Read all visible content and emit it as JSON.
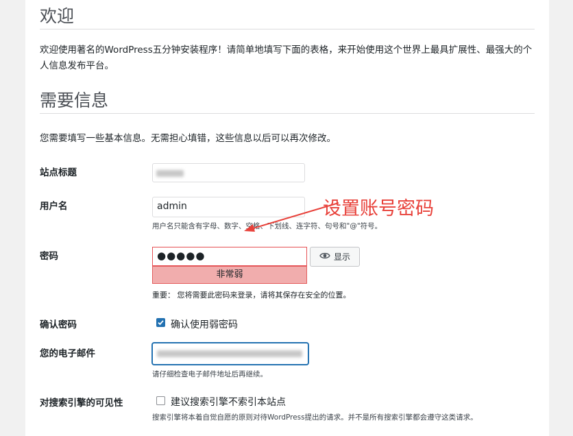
{
  "welcome": {
    "title": "欢迎",
    "intro": "欢迎使用著名的WordPress五分钟安装程序！请简单地填写下面的表格，来开始使用这个世界上最具扩展性、最强大的个人信息发布平台。"
  },
  "info": {
    "title": "需要信息",
    "description": "您需要填写一些基本信息。无需担心填错，这些信息以后可以再次修改。"
  },
  "form": {
    "site_title": {
      "label": "站点标题",
      "value": ""
    },
    "username": {
      "label": "用户名",
      "value": "admin",
      "hint": "用户名只能含有字母、数字、空格、下划线、连字符、句号和\"@\"符号。"
    },
    "password": {
      "label": "密码",
      "value": "●●●●●",
      "strength": "非常弱",
      "show_button": "显示",
      "important": "重要：  您将需要此密码来登录，请将其保存在安全的位置。"
    },
    "confirm_password": {
      "label": "确认密码",
      "checkbox_label": "确认使用弱密码",
      "checked": true
    },
    "email": {
      "label": "您的电子邮件",
      "value": "",
      "hint": "请仔细检查电子邮件地址后再继续。"
    },
    "visibility": {
      "label": "对搜索引擎的可见性",
      "checkbox_label": "建议搜索引擎不索引本站点",
      "checked": false,
      "hint": "搜索引擎将本着自觉自愿的原则对待WordPress提出的请求。并不是所有搜索引擎都会遵守这类请求。"
    }
  },
  "annotation": {
    "text": "设置账号密码",
    "color": "#e8413a"
  },
  "colors": {
    "accent": "#2271b1",
    "danger": "#e65054",
    "strength_weak_bg": "#f1adad"
  },
  "icons": {
    "show_password": "eye-icon"
  }
}
